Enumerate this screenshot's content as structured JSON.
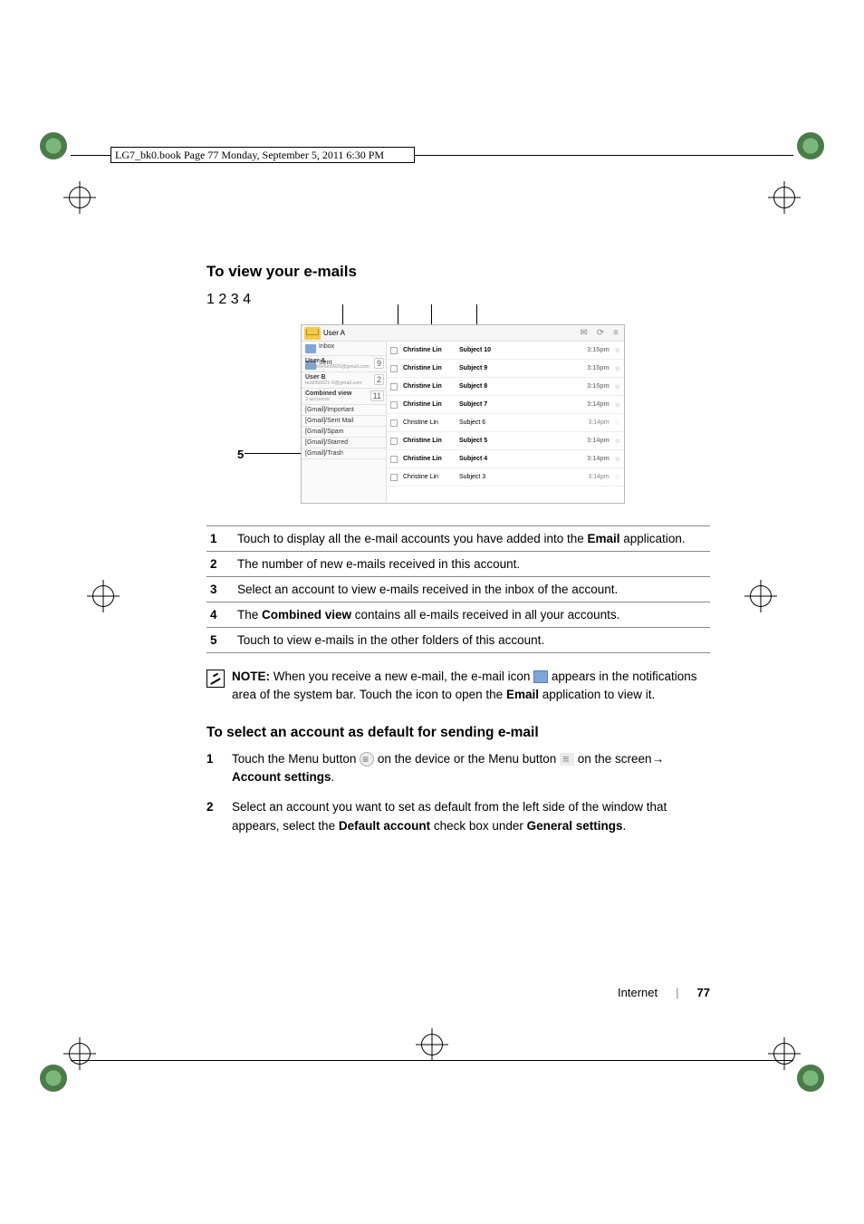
{
  "meta_header": "LG7_bk0.book  Page 77  Monday, September 5, 2011  6:30 PM",
  "section_title_1": "To view your e-mails",
  "callout_labels": {
    "c1": "1",
    "c2": "2",
    "c3": "3",
    "c4": "4",
    "c5": "5"
  },
  "tablet": {
    "header_account": "User A",
    "header_icons": {
      "search": "⌕",
      "refresh": "⟳",
      "menu": "≡",
      "other": "✉"
    },
    "drawer": {
      "inbox_label": "Inbox",
      "sent_label": "Sent",
      "gmx1": "[Gma",
      "gmx2": "[Gma",
      "accounts": [
        {
          "name": "User A",
          "sub": "christinelun0920@gmail.com",
          "count": "9"
        },
        {
          "name": "User B",
          "sub": "test050921-0@gmail.com",
          "count": "2"
        },
        {
          "name": "Combined view",
          "sub": "2 accounts",
          "count": "11"
        }
      ],
      "folders": [
        "[Gmail]/Important",
        "[Gmail]/Sent Mail",
        "[Gmail]/Spam",
        "[Gmail]/Starred",
        "[Gmail]/Trash"
      ]
    },
    "mails": [
      {
        "from": "Christine Lin",
        "subject": "Subject 10",
        "time": "3:15pm",
        "bold": true
      },
      {
        "from": "Christine Lin",
        "subject": "Subject 9",
        "time": "3:15pm",
        "bold": true
      },
      {
        "from": "Christine Lin",
        "subject": "Subject 8",
        "time": "3:15pm",
        "bold": true
      },
      {
        "from": "Christine Lin",
        "subject": "Subject 7",
        "time": "3:14pm",
        "bold": true
      },
      {
        "from": "Christine Lin",
        "subject": "Subject 6",
        "time": "3:14pm",
        "bold": false
      },
      {
        "from": "Christine Lin",
        "subject": "Subject 5",
        "time": "3:14pm",
        "bold": true
      },
      {
        "from": "Christine Lin",
        "subject": "Subject 4",
        "time": "3:14pm",
        "bold": true
      },
      {
        "from": "Christine Lin",
        "subject": "Subject 3",
        "time": "3:14pm",
        "bold": false
      }
    ]
  },
  "defs": {
    "d1_a": "Touch to display all the e-mail accounts you have added into the ",
    "d1_b": "Email",
    "d1_c": " application.",
    "d2": "The number of new e-mails received in this account.",
    "d3": "Select an account to view e-mails received in the inbox of the account.",
    "d4_a": "The ",
    "d4_b": "Combined view",
    "d4_c": " contains all e-mails received in all your accounts.",
    "d5": "Touch to view e-mails in the other folders of this account."
  },
  "note": {
    "lead": "NOTE:",
    "a": " When you receive a new e-mail, the e-mail icon ",
    "b": " appears in the notifications area of the system bar. Touch the icon to open the ",
    "c": "Email",
    "d": " application to view it."
  },
  "section_title_2": "To select an account as default for sending e-mail",
  "steps": {
    "s1_a": "Touch the Menu button ",
    "s1_b": " on the device or the Menu button ",
    "s1_c": " on the screen",
    "s1_arrow": "→ ",
    "s1_d": "Account settings",
    "s1_e": ".",
    "s2_a": "Select an account you want to set as default from the left side of the window that appears, select the ",
    "s2_b": "Default account",
    "s2_c": " check box under ",
    "s2_d": "General settings",
    "s2_e": "."
  },
  "footer": {
    "section": "Internet",
    "page": "77"
  }
}
